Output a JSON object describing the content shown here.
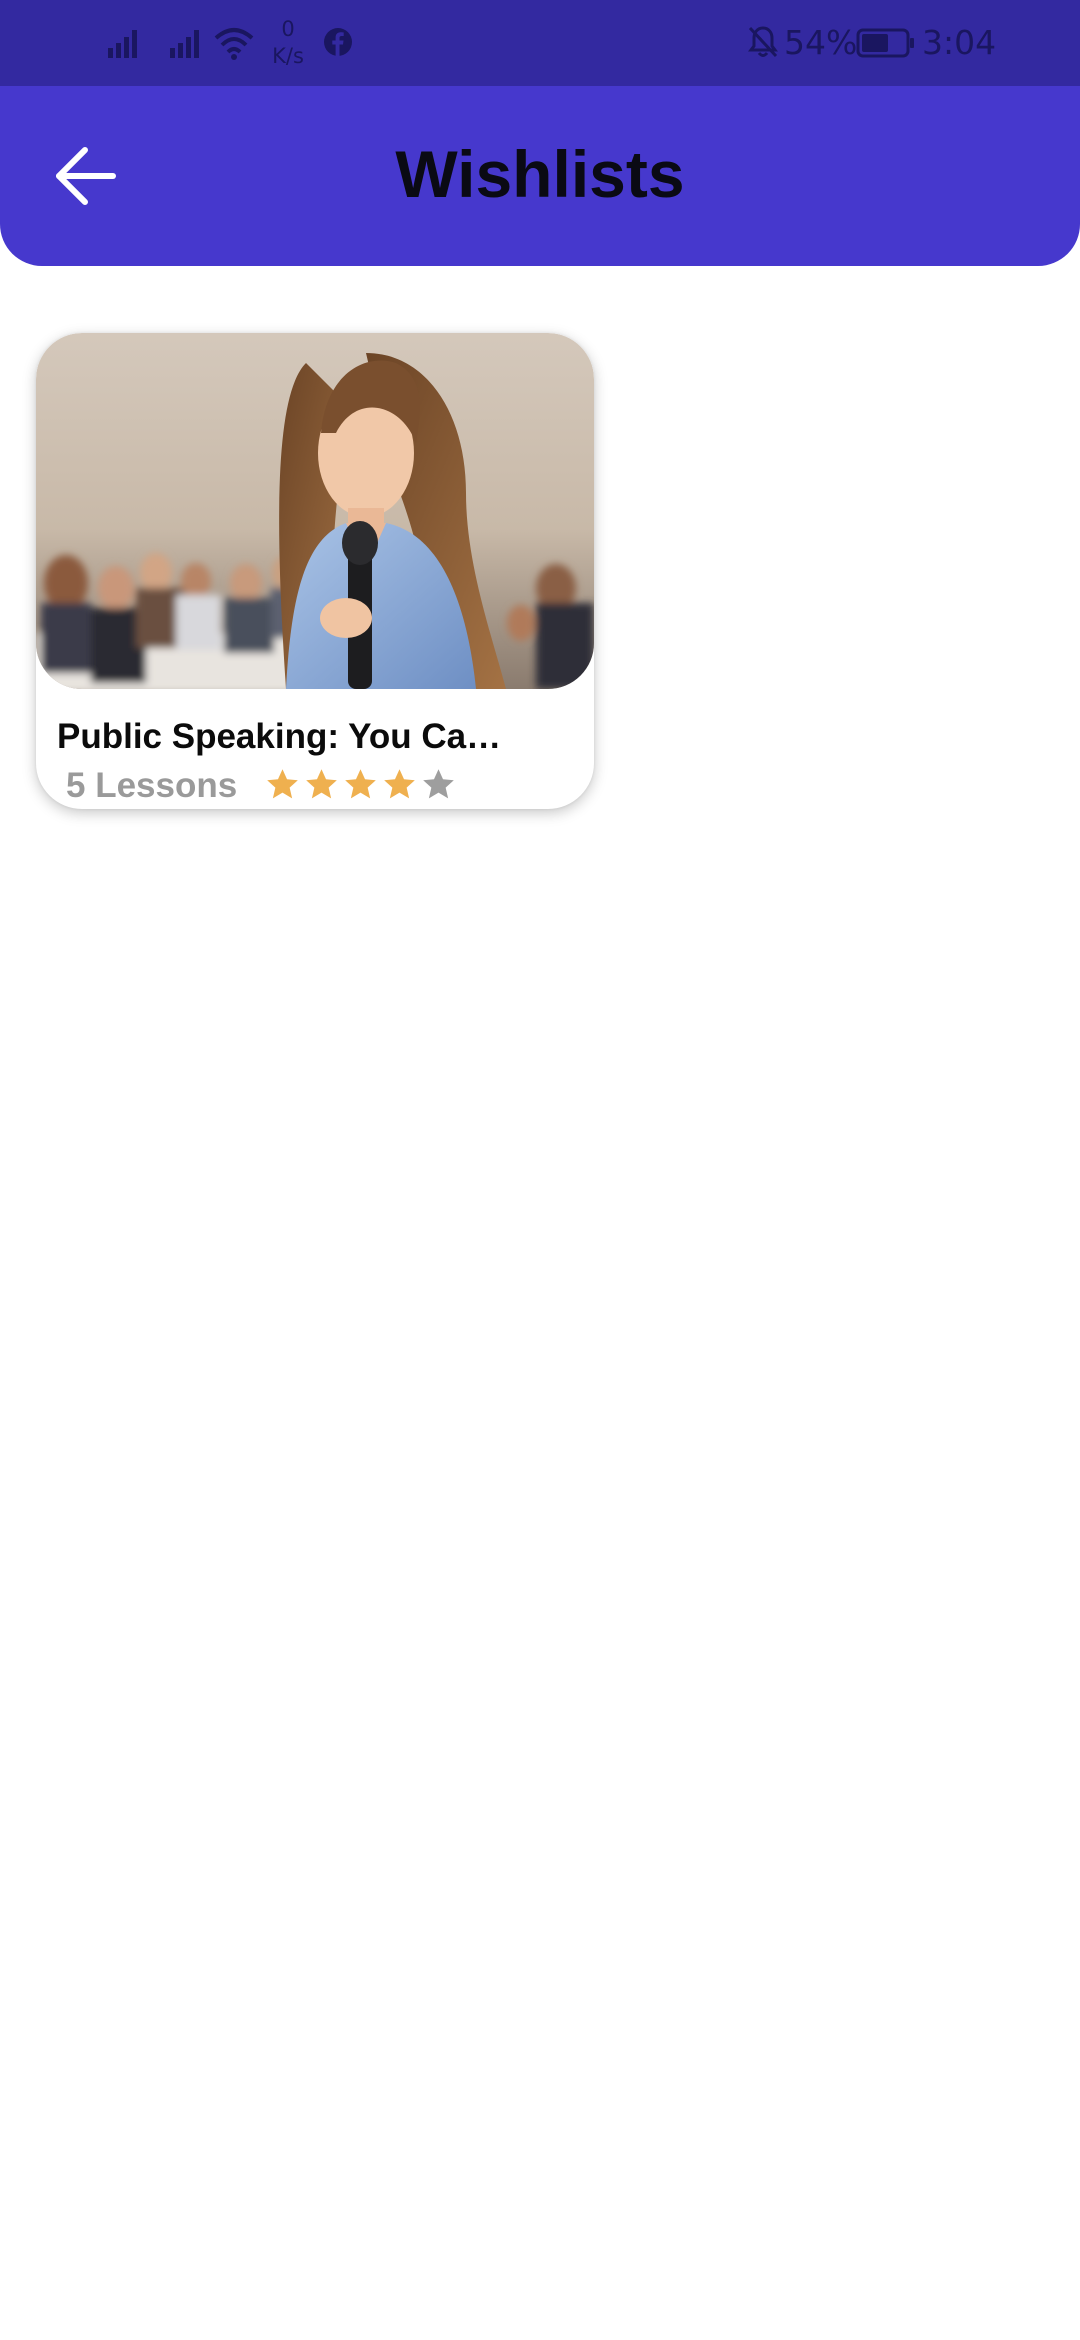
{
  "status_bar": {
    "net_speed_value": "0",
    "net_speed_unit": "K/s",
    "battery_percent": "54%",
    "time": "3:04",
    "icons": [
      "signal-icon",
      "signal-icon",
      "wifi-icon",
      "facebook-icon",
      "notifications-off-icon",
      "battery-icon"
    ]
  },
  "header": {
    "title": "Wishlists",
    "back_icon": "arrow-left-icon",
    "background": "#4638cd"
  },
  "wishlist": {
    "items": [
      {
        "title": "Public Speaking: You Ca…",
        "lessons": "5 Lessons",
        "rating": 4,
        "rating_max": 5,
        "star_color": "#efb04f",
        "star_empty_color": "#9e9e9e"
      }
    ]
  }
}
